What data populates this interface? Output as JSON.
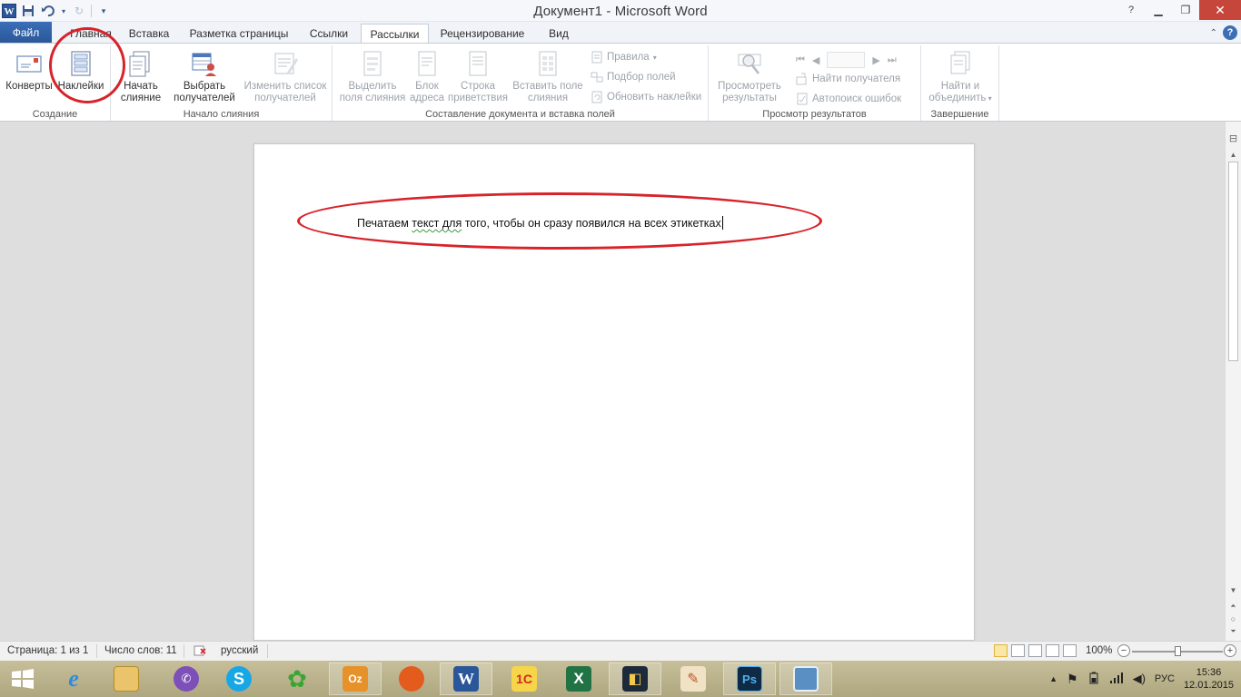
{
  "window": {
    "title": "Документ1  -  Microsoft Word",
    "app_icon_letter": "W"
  },
  "tabs": [
    {
      "label": "Файл"
    },
    {
      "label": "Главная"
    },
    {
      "label": "Вставка"
    },
    {
      "label": "Разметка страницы"
    },
    {
      "label": "Ссылки"
    },
    {
      "label": "Рассылки"
    },
    {
      "label": "Рецензирование"
    },
    {
      "label": "Вид"
    }
  ],
  "active_tab": "Рассылки",
  "ribbon": {
    "groups": {
      "create": "Создание",
      "start_merge": "Начало слияния",
      "write_insert": "Составление документа и вставка полей",
      "preview": "Просмотр результатов",
      "finish": "Завершение"
    },
    "envelopes": "Конверты",
    "labels": "Наклейки",
    "start_merge_1": "Начать",
    "start_merge_2": "слияние",
    "select_recipients_1": "Выбрать",
    "select_recipients_2": "получателей",
    "edit_list_1": "Изменить список",
    "edit_list_2": "получателей",
    "highlight_1": "Выделить",
    "highlight_2": "поля слияния",
    "address_1": "Блок",
    "address_2": "адреса",
    "greeting_1": "Строка",
    "greeting_2": "приветствия",
    "insert_field_1": "Вставить поле",
    "insert_field_2": "слияния",
    "rules": "Правила",
    "match_fields": "Подбор полей",
    "update_labels": "Обновить наклейки",
    "preview_1": "Просмотреть",
    "preview_2": "результаты",
    "find_recipient": "Найти получателя",
    "auto_check": "Автопоиск ошибок",
    "finish_1": "Найти и",
    "finish_2": "объединить"
  },
  "document": {
    "text_before": "Печатаем ",
    "text_squiggle": "текст для",
    "text_after": " того, чтобы он сразу появился на всех этикетках"
  },
  "status": {
    "page": "Страница: 1 из 1",
    "words": "Число слов: 11",
    "language": "русский",
    "zoom": "100%",
    "zoom_value": 100
  },
  "taskbar": {
    "lang": "РУС",
    "time": "15:36",
    "date": "12.01.2015"
  },
  "colors": {
    "accent": "#2b579a",
    "annotation": "#d8232a"
  }
}
